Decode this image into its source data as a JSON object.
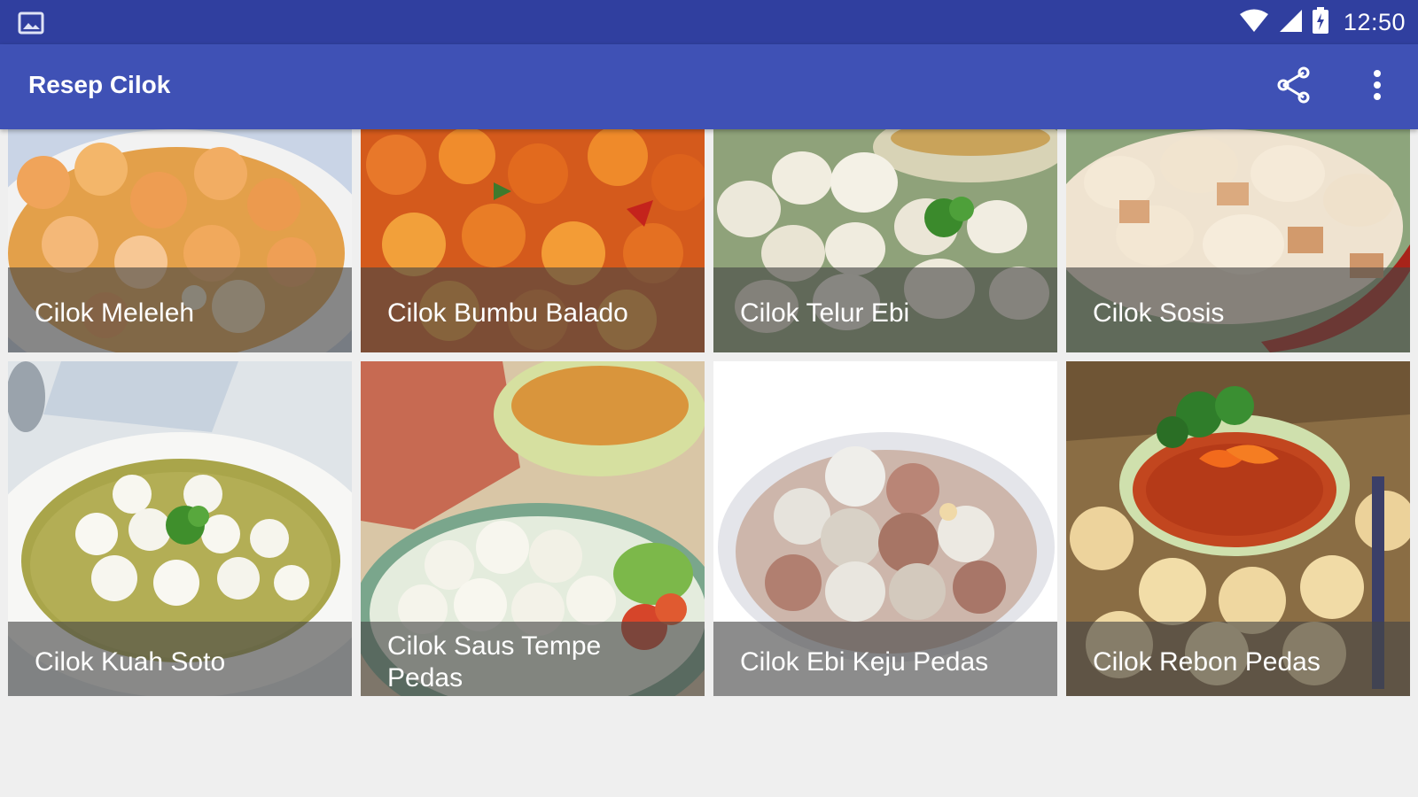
{
  "status_bar": {
    "time": "12:50",
    "icons": [
      "image-notification-icon",
      "wifi-icon",
      "signal-icon",
      "battery-charging-icon"
    ]
  },
  "app_bar": {
    "title": "Resep Cilok",
    "actions": [
      "share-icon",
      "more-vert-icon"
    ]
  },
  "recipes": [
    {
      "title": "Cilok Meleleh"
    },
    {
      "title": "Cilok Bumbu Balado"
    },
    {
      "title": "Cilok Telur Ebi"
    },
    {
      "title": "Cilok Sosis"
    },
    {
      "title": "Cilok Kuah Soto"
    },
    {
      "title": "Cilok Saus Tempe Pedas"
    },
    {
      "title": "Cilok Ebi Keju Pedas"
    },
    {
      "title": "Cilok Rebon Pedas"
    }
  ],
  "colors": {
    "status_bar": "#303f9f",
    "app_bar": "#3f51b5",
    "background": "#efefef"
  }
}
